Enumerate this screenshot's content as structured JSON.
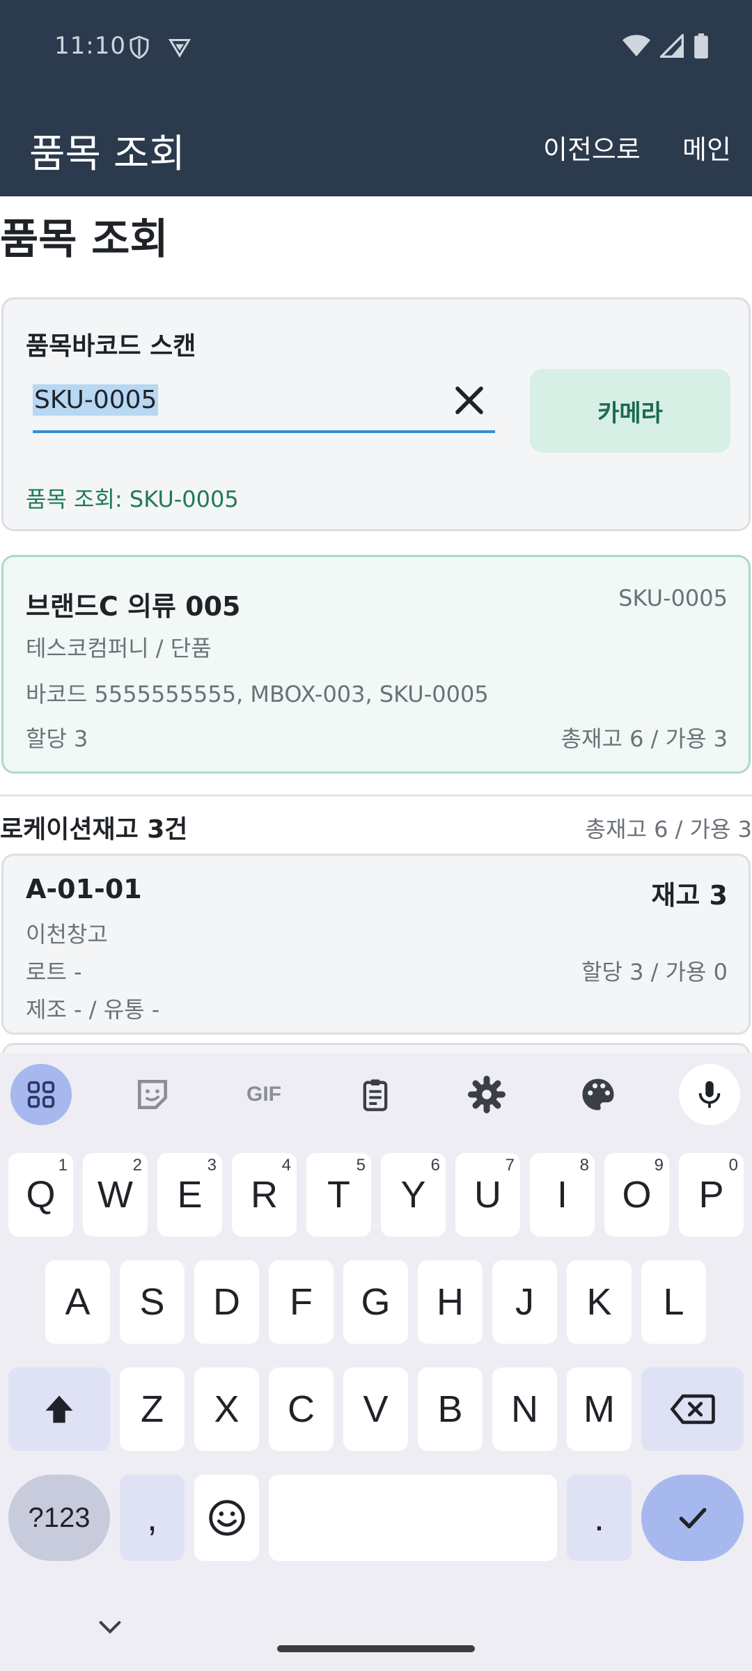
{
  "status_bar": {
    "time": "11:10"
  },
  "app_bar": {
    "title": "품목 조회",
    "back_label": "이전으로",
    "main_label": "메인"
  },
  "page": {
    "title": "품목 조회"
  },
  "scan": {
    "label": "품목바코드 스캔",
    "input_value": "SKU-0005",
    "camera_label": "카메라",
    "status_text": "품목 조회: SKU-0005"
  },
  "item": {
    "name": "브랜드C 의류 005",
    "sku": "SKU-0005",
    "company_type": "테스코컴퍼니 / 단품",
    "barcodes": "바코드 5555555555, MBOX-003, SKU-0005",
    "allocated": "할당 3",
    "stock_summary": "총재고 6 / 가용 3"
  },
  "location_section": {
    "header": "로케이션재고 3건",
    "summary": "총재고 6 / 가용 3"
  },
  "locations": [
    {
      "code": "A-01-01",
      "stock": "재고 3",
      "warehouse": "이천창고",
      "lot": "로트 -",
      "alloc_avail": "할당 3 / 가용 0",
      "dates": "제조 - / 유통 -"
    }
  ],
  "keyboard": {
    "row1": [
      {
        "key": "Q",
        "hint": "1"
      },
      {
        "key": "W",
        "hint": "2"
      },
      {
        "key": "E",
        "hint": "3"
      },
      {
        "key": "R",
        "hint": "4"
      },
      {
        "key": "T",
        "hint": "5"
      },
      {
        "key": "Y",
        "hint": "6"
      },
      {
        "key": "U",
        "hint": "7"
      },
      {
        "key": "I",
        "hint": "8"
      },
      {
        "key": "O",
        "hint": "9"
      },
      {
        "key": "P",
        "hint": "0"
      }
    ],
    "row2": [
      "A",
      "S",
      "D",
      "F",
      "G",
      "H",
      "J",
      "K",
      "L"
    ],
    "row3": [
      "Z",
      "X",
      "C",
      "V",
      "B",
      "N",
      "M"
    ],
    "symbols_label": "?123",
    "comma": ",",
    "period": ".",
    "gif_label": "GIF",
    "icons": [
      "apps-icon",
      "sticker-icon",
      "gif-icon",
      "clipboard-icon",
      "settings-icon",
      "palette-icon",
      "mic-icon",
      "shift-icon",
      "backspace-icon",
      "emoji-icon",
      "check-icon",
      "chevron-down-icon"
    ]
  },
  "colors": {
    "app_bar": "#2b3a4c",
    "accent_green": "#1e7a57",
    "input_underline": "#2f8fd8",
    "keyboard_bg": "#eeedf4"
  }
}
